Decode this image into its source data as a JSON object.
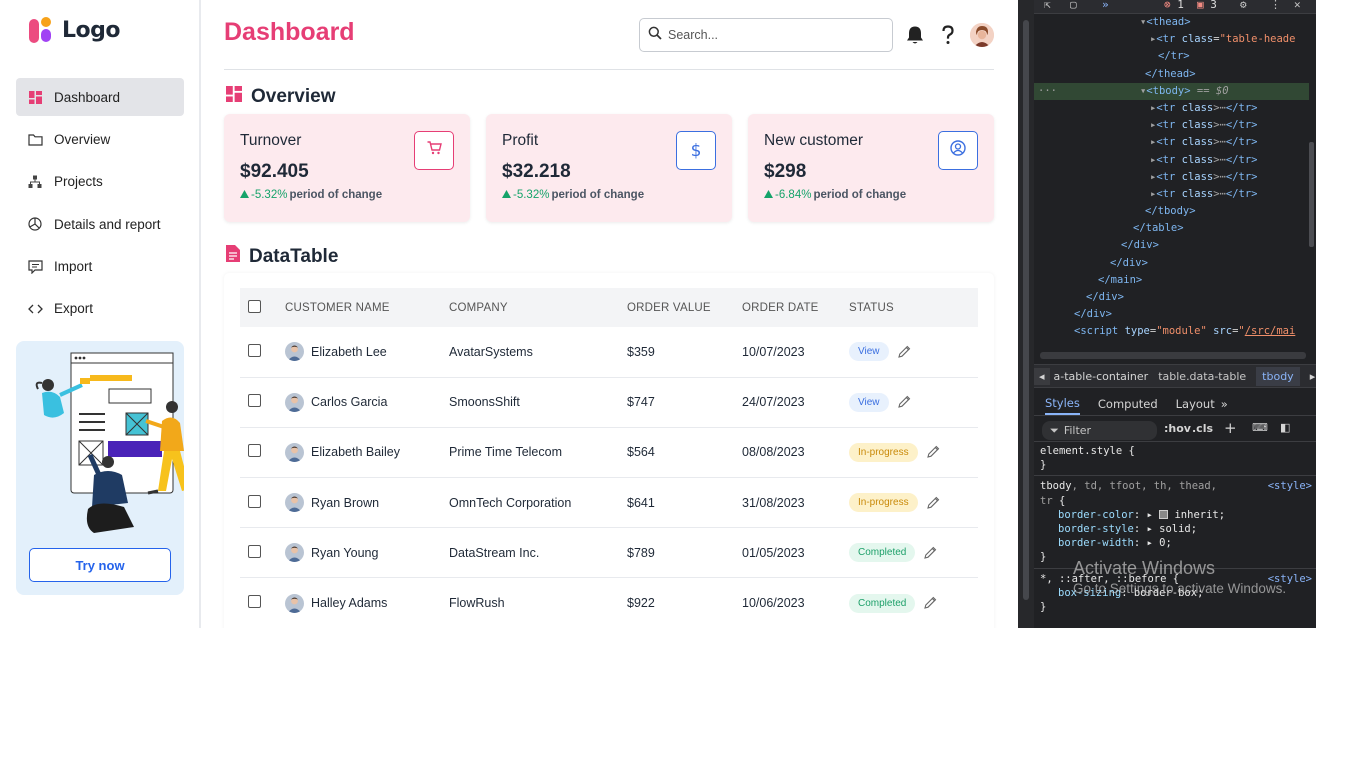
{
  "logo": {
    "text": "Logo"
  },
  "sidebar": {
    "items": [
      {
        "label": "Dashboard",
        "icon": "dashboard-grid-icon",
        "active": true
      },
      {
        "label": "Overview",
        "icon": "folder-icon"
      },
      {
        "label": "Projects",
        "icon": "hierarchy-icon"
      },
      {
        "label": "Details and report",
        "icon": "pie-chart-icon"
      },
      {
        "label": "Import",
        "icon": "message-square-icon"
      },
      {
        "label": "Export",
        "icon": "code-icon"
      }
    ],
    "promo": {
      "button_label": "Try now"
    }
  },
  "header": {
    "title": "Dashboard",
    "search_placeholder": "Search..."
  },
  "overview": {
    "title": "Overview",
    "cards": [
      {
        "title": "Turnover",
        "value": "$92.405",
        "change": "-5.32%",
        "change_label": "period of change",
        "icon": "shopping-cart-icon",
        "icon_color": "#e63e75"
      },
      {
        "title": "Profit",
        "value": "$32.218",
        "change": "-5.32%",
        "change_label": "period of change",
        "icon": "dollar-icon",
        "icon_color": "#3b6fe0"
      },
      {
        "title": "New customer",
        "value": "$298",
        "change": "-6.84%",
        "change_label": "period of change",
        "icon": "user-circle-icon",
        "icon_color": "#3b6fe0"
      }
    ]
  },
  "datatable": {
    "title": "DataTable",
    "columns": [
      "CUSTOMER NAME",
      "COMPANY",
      "ORDER VALUE",
      "ORDER DATE",
      "STATUS"
    ],
    "rows": [
      {
        "name": "Elizabeth Lee",
        "company": "AvatarSystems",
        "value": "$359",
        "date": "10/07/2023",
        "status": "View"
      },
      {
        "name": "Carlos Garcia",
        "company": "SmoonsShift",
        "value": "$747",
        "date": "24/07/2023",
        "status": "View"
      },
      {
        "name": "Elizabeth Bailey",
        "company": "Prime Time Telecom",
        "value": "$564",
        "date": "08/08/2023",
        "status": "In-progress"
      },
      {
        "name": "Ryan Brown",
        "company": "OmnTech Corporation",
        "value": "$641",
        "date": "31/08/2023",
        "status": "In-progress"
      },
      {
        "name": "Ryan Young",
        "company": "DataStream Inc.",
        "value": "$789",
        "date": "01/05/2023",
        "status": "Completed"
      },
      {
        "name": "Halley Adams",
        "company": "FlowRush",
        "value": "$922",
        "date": "10/06/2023",
        "status": "Completed"
      }
    ]
  },
  "colors": {
    "accent": "#e63e75",
    "view_bg": "#e8f1fd",
    "view_fg": "#3b6fe0",
    "progress_bg": "#fdf1c9",
    "progress_fg": "#c98a0a",
    "completed_bg": "#e4f7ee",
    "completed_fg": "#1ea06a"
  },
  "devtools": {
    "errors": "1",
    "issues": "3",
    "breadcrumbs": [
      "a-table-container",
      "table.data-table",
      "tbody"
    ],
    "tabs": [
      "Styles",
      "Computed",
      "Layout"
    ],
    "filter_placeholder": "Filter",
    "hov": ":hov",
    "cls": ".cls",
    "watermark_title": "Activate Windows",
    "watermark_sub": "Go to Settings to activate Windows."
  }
}
